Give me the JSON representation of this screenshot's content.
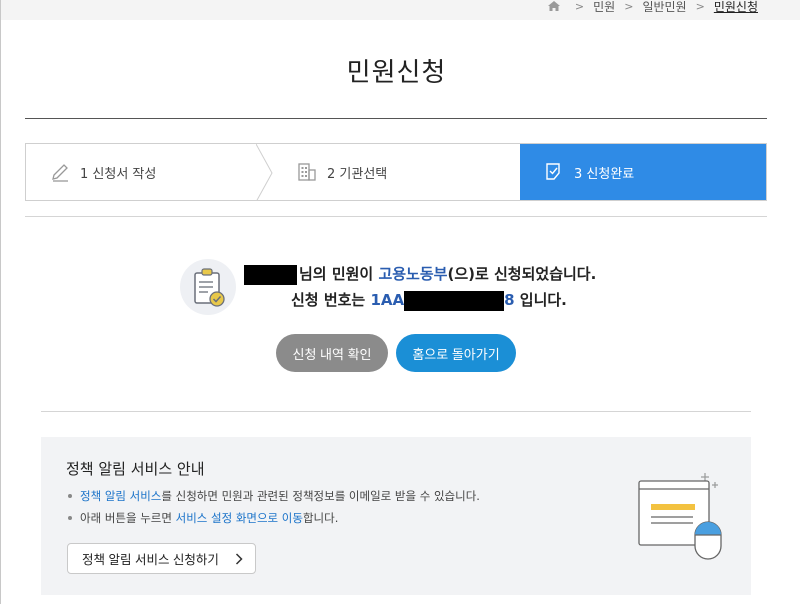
{
  "breadcrumb": {
    "items": [
      "민원",
      "일반민원",
      "민원신청"
    ]
  },
  "page": {
    "title": "민원신청"
  },
  "steps": [
    {
      "label": "1 신청서 작성"
    },
    {
      "label": "2 기관선택"
    },
    {
      "label": "3 신청완료",
      "active": true
    }
  ],
  "result": {
    "line1_suffix": "님의 민원이 ",
    "agency": "고용노동부",
    "line1_end": "(으)로 신청되었습니다.",
    "line2_prefix": "신청 번호는 ",
    "number_start": "1AA",
    "number_end": "8",
    "line2_end": " 입니다."
  },
  "buttons": {
    "history": "신청 내역 확인",
    "home": "홈으로 돌아가기"
  },
  "info": {
    "title": "정책 알림 서비스 안내",
    "item1_link": "정책 알림 서비스",
    "item1_text": "를 신청하면 민원과 관련된 정책정보를 이메일로 받을 수 있습니다.",
    "item2_prefix": "아래 버튼을 누르면 ",
    "item2_link": "서비스 설정 화면으로 이동",
    "item2_suffix": "합니다.",
    "button": "정책 알림 서비스 신청하기"
  },
  "colors": {
    "accent": "#2f8be6",
    "home_button": "#1b8fd6",
    "history_button": "#8b8b8b",
    "link": "#1b73c9",
    "agency": "#2a5db0"
  },
  "icons": [
    "home-icon",
    "pencil-icon",
    "building-icon",
    "check-document-icon",
    "clipboard-check-icon",
    "chevron-right-icon",
    "browser-mouse-illustration"
  ]
}
